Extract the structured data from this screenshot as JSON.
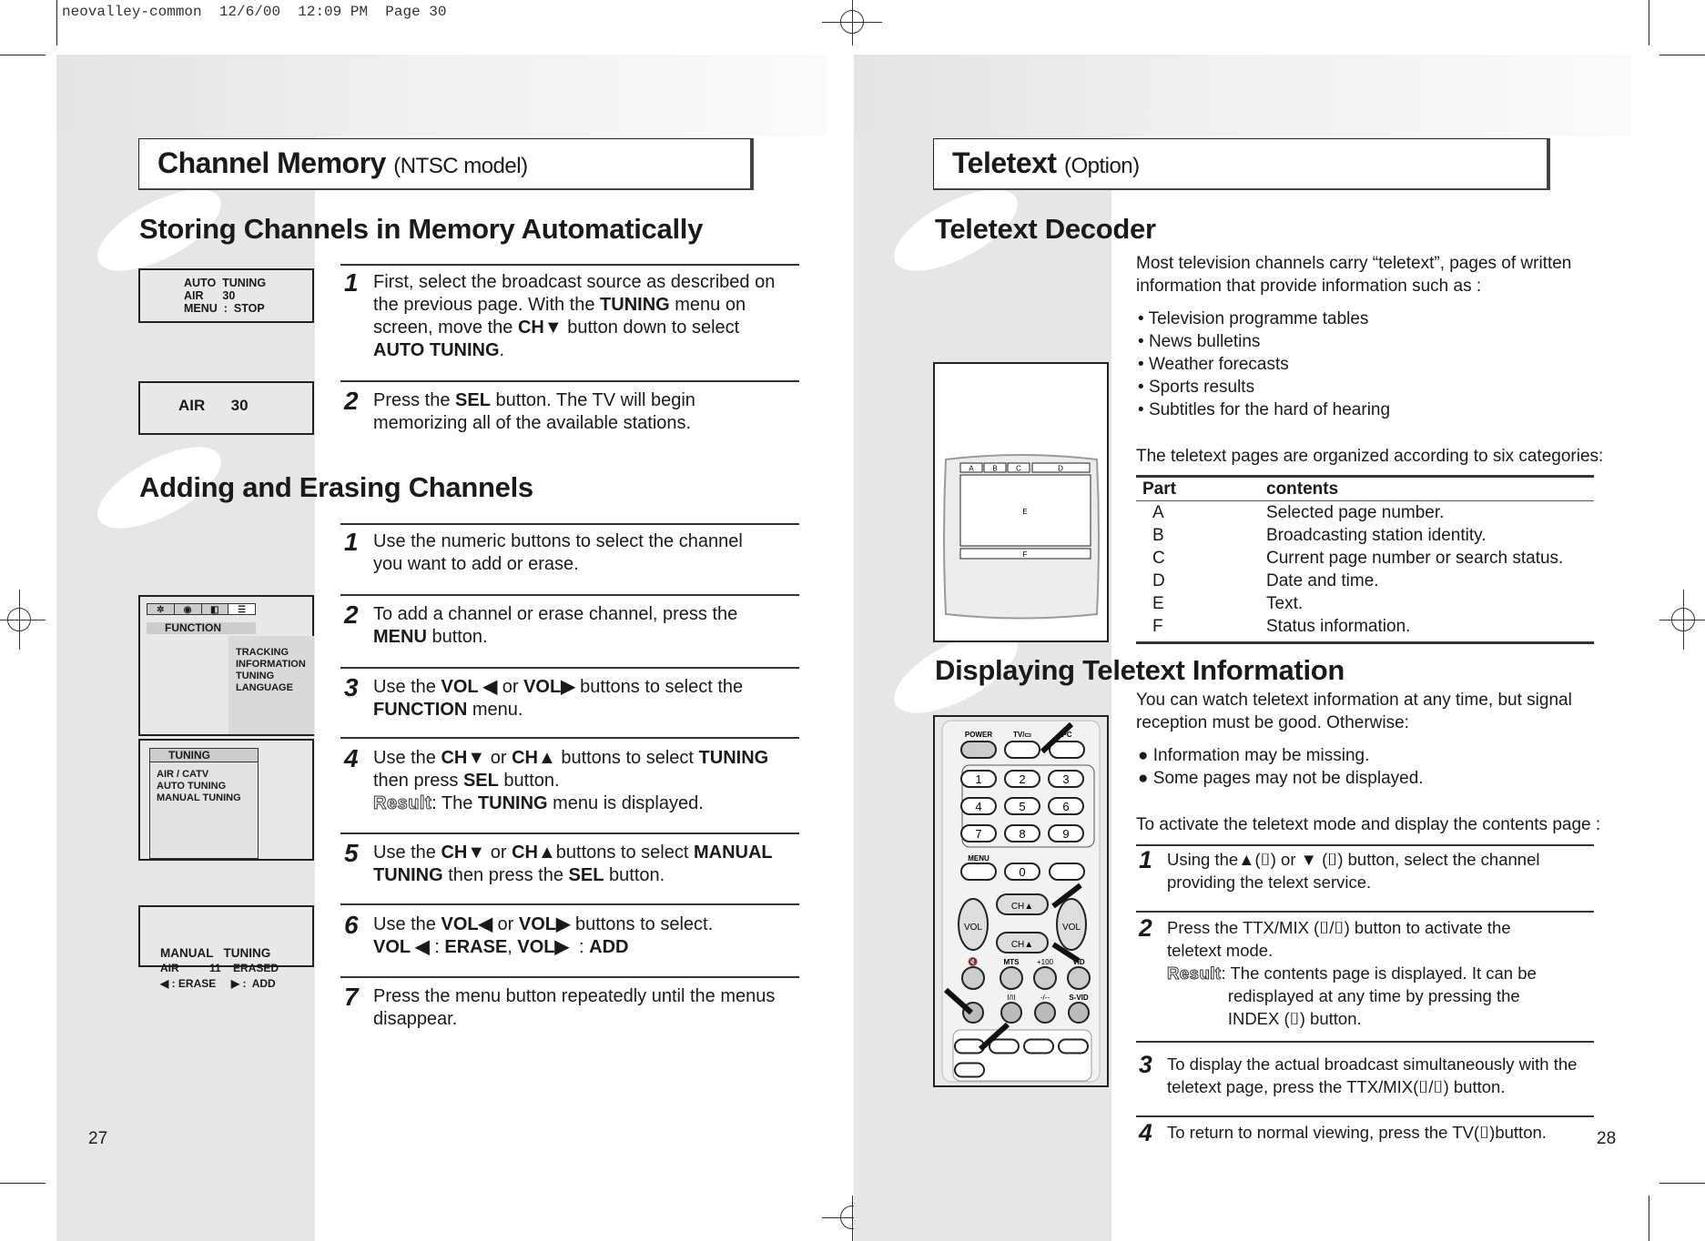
{
  "slug": "neovalley-common  12/6/00  12:09 PM  Page 30",
  "left": {
    "title": "Channel Memory",
    "title_sub": "(NTSC model)",
    "section1": "Storing Channels in Memory Automatically",
    "section2": "Adding and Erasing Channels",
    "osd1": [
      "AUTO  TUNING",
      "AIR      30",
      "MENU  :  STOP"
    ],
    "osd2": "AIR      30",
    "osd3": {
      "tabs": [
        "gear-icon",
        "picture-icon",
        "sound-icon",
        "function-icon"
      ],
      "label": "FUNCTION",
      "items": [
        "TRACKING",
        "INFORMATION",
        "TUNING",
        "LANGUAGE"
      ]
    },
    "osd4": {
      "label": "TUNING",
      "items": [
        "AIR / CATV",
        "AUTO  TUNING",
        "MANUAL  TUNING"
      ]
    },
    "osd5": [
      "MANUAL   TUNING",
      "AIR          11    ERASED",
      "◀ : ERASE     ▶ :  ADD"
    ],
    "steps1": [
      {
        "n": "1",
        "lines": [
          [
            [
              "First, select the broadcast source as described on",
              ""
            ]
          ],
          [
            [
              "the previous page. With the ",
              ""
            ],
            [
              "TUNING",
              "b"
            ],
            [
              " menu on",
              ""
            ]
          ],
          [
            [
              "screen, move the ",
              ""
            ],
            [
              "CH▼",
              "b"
            ],
            [
              " button down to select",
              ""
            ]
          ],
          [
            [
              "AUTO TUNING",
              "b"
            ],
            [
              ".",
              ""
            ]
          ]
        ]
      },
      {
        "n": "2",
        "lines": [
          [
            [
              "Press the ",
              ""
            ],
            [
              "SEL",
              "b"
            ],
            [
              " button. The TV will begin",
              ""
            ]
          ],
          [
            [
              "memorizing all of the available stations.",
              ""
            ]
          ]
        ]
      }
    ],
    "steps2": [
      {
        "n": "1",
        "lines": [
          [
            [
              "Use the numeric buttons to select the channel",
              ""
            ]
          ],
          [
            [
              "you want to add or erase.",
              ""
            ]
          ]
        ]
      },
      {
        "n": "2",
        "lines": [
          [
            [
              "To add a channel or erase channel, press the",
              ""
            ]
          ],
          [
            [
              "MENU",
              "b"
            ],
            [
              " button.",
              ""
            ]
          ]
        ]
      },
      {
        "n": "3",
        "lines": [
          [
            [
              "Use the ",
              ""
            ],
            [
              "VOL ◀",
              "b"
            ],
            [
              " or ",
              ""
            ],
            [
              "VOL▶",
              "b"
            ],
            [
              " buttons to select the",
              ""
            ]
          ],
          [
            [
              "FUNCTION",
              "b"
            ],
            [
              " menu.",
              ""
            ]
          ]
        ]
      },
      {
        "n": "4",
        "lines": [
          [
            [
              "Use the ",
              ""
            ],
            [
              "CH▼",
              "b"
            ],
            [
              " or ",
              ""
            ],
            [
              "CH▲",
              "b"
            ],
            [
              " buttons to select ",
              ""
            ],
            [
              "TUNING",
              "b"
            ]
          ],
          [
            [
              "then press ",
              ""
            ],
            [
              "SEL",
              "b"
            ],
            [
              " button.",
              ""
            ]
          ],
          [
            [
              "Result",
              "r"
            ],
            [
              ": The ",
              ""
            ],
            [
              "TUNING",
              "b"
            ],
            [
              " menu is displayed.",
              ""
            ]
          ]
        ]
      },
      {
        "n": "5",
        "lines": [
          [
            [
              "Use the ",
              ""
            ],
            [
              "CH▼",
              "b"
            ],
            [
              " or ",
              ""
            ],
            [
              "CH▲",
              "b"
            ],
            [
              "buttons to select ",
              ""
            ],
            [
              "MANUAL",
              "b"
            ]
          ],
          [
            [
              "TUNING",
              "b"
            ],
            [
              " then press the ",
              ""
            ],
            [
              "SEL",
              "b"
            ],
            [
              " button.",
              ""
            ]
          ]
        ]
      },
      {
        "n": "6",
        "lines": [
          [
            [
              "Use the ",
              ""
            ],
            [
              "VOL◀",
              "b"
            ],
            [
              " or ",
              ""
            ],
            [
              "VOL▶",
              "b"
            ],
            [
              " buttons to select.",
              ""
            ]
          ],
          [
            [
              "VOL ◀",
              "b"
            ],
            [
              " : ",
              ""
            ],
            [
              "ERASE",
              "b"
            ],
            [
              ", ",
              ""
            ],
            [
              "VOL▶",
              "b"
            ],
            [
              "  : ",
              ""
            ],
            [
              "ADD",
              "b"
            ]
          ]
        ]
      },
      {
        "n": "7",
        "lines": [
          [
            [
              "Press the menu button repeatedly until the menus",
              ""
            ]
          ],
          [
            [
              "disappear.",
              ""
            ]
          ]
        ]
      }
    ],
    "page_number": "27"
  },
  "right": {
    "title": "Teletext",
    "title_sub": "(Option)",
    "section1": "Teletext Decoder",
    "intro": [
      "Most television channels carry “teletext”, pages of written",
      "information that provide information such as :"
    ],
    "bullets": [
      "Television programme tables",
      "News bulletins",
      "Weather forecasts",
      "Sports results",
      "Subtitles for the hard of hearing"
    ],
    "table_intro": "The teletext pages are organized according to six categories:",
    "table": {
      "headers": [
        "Part",
        "contents"
      ],
      "rows": [
        [
          "A",
          "Selected page number."
        ],
        [
          "B",
          "Broadcasting station identity."
        ],
        [
          "C",
          "Current page number or search status."
        ],
        [
          "D",
          "Date and time."
        ],
        [
          "E",
          "Text."
        ],
        [
          "F",
          "Status information."
        ]
      ]
    },
    "tv_labels": [
      "A",
      "B",
      "C",
      "D",
      "E",
      "F"
    ],
    "section2": "Displaying Teletext Information",
    "intro2": [
      "You can watch teletext information at any time, but signal",
      "reception must be good. Otherwise:"
    ],
    "bullets2": [
      "Information may be missing.",
      "Some pages may not be displayed."
    ],
    "activate": "To activate the teletext mode and display the contents page :",
    "steps": [
      {
        "n": "1",
        "lines": [
          [
            [
              "Using the▲(⌷) or ▼ (⌷) button, select the channel",
              ""
            ]
          ],
          [
            [
              "providing the telext service.",
              ""
            ]
          ]
        ]
      },
      {
        "n": "2",
        "lines": [
          [
            [
              "Press the TTX/MIX (⌷/⌷) button to activate the",
              ""
            ]
          ],
          [
            [
              "teletext mode.",
              ""
            ]
          ],
          [
            [
              "Result",
              "r"
            ],
            [
              ": The contents page is displayed. It can be",
              ""
            ]
          ],
          [
            [
              "             redisplayed at any time by pressing the",
              ""
            ]
          ],
          [
            [
              "             INDEX (⌷) button.",
              ""
            ]
          ]
        ]
      },
      {
        "n": "3",
        "lines": [
          [
            [
              "To display the actual broadcast simultaneously with the",
              ""
            ]
          ],
          [
            [
              "teletext page, press the TTX/MIX(⌷/⌷) button.",
              ""
            ]
          ]
        ]
      },
      {
        "n": "4",
        "lines": [
          [
            [
              "To return to normal viewing, press the TV(⌷)button.",
              ""
            ]
          ]
        ]
      }
    ],
    "remote": {
      "power": "POWER",
      "tv": "TV/▭",
      "pc": "PC",
      "digits": [
        "1",
        "2",
        "3",
        "4",
        "5",
        "6",
        "7",
        "8",
        "9",
        "0"
      ],
      "menu": "MENU",
      "ch_up": "CH▲",
      "ch_down": "CH▲",
      "vol_left": "VOL",
      "vol_right": "VOL",
      "mute": "🔇",
      "mts": "MTS",
      "plus100": "+100",
      "vid": "VID",
      "i_ii": "I/II",
      "dash": "-/--",
      "svid": "S-VID"
    },
    "page_number": "28"
  }
}
